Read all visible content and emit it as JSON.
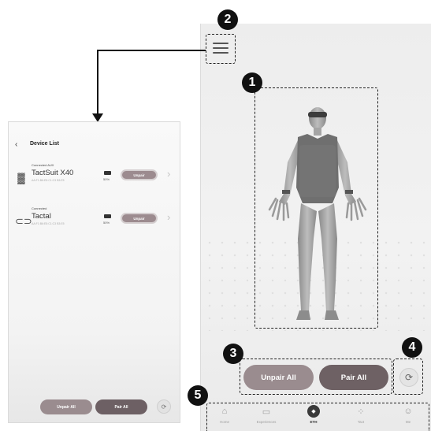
{
  "badges": [
    "1",
    "2",
    "3",
    "4",
    "5"
  ],
  "main": {
    "menu_icon": "hamburger-menu-icon",
    "unpair_all": "Unpair All",
    "pair_all": "Pair All",
    "refresh_icon": "refresh-icon",
    "refresh_glyph": "⟳"
  },
  "nav": {
    "items": [
      {
        "label": "Home",
        "icon": "home-icon",
        "glyph": "⌂"
      },
      {
        "label": "Experiences",
        "icon": "gamepad-icon",
        "glyph": "▭"
      },
      {
        "label": "ETH",
        "icon": "eth-icon",
        "glyph": "◆"
      },
      {
        "label": "Tact",
        "icon": "grid-icon",
        "glyph": "⁘"
      },
      {
        "label": "Me",
        "icon": "profile-icon",
        "glyph": "☺"
      }
    ],
    "active_index": 2
  },
  "device_list": {
    "title": "Device List",
    "back_glyph": "‹",
    "devices": [
      {
        "status": "Connected  AUX",
        "name": "TactSuit X40",
        "serial": "AA:F1:B6:E5:C1:C3 B3:E5",
        "battery": "50%",
        "unpair": "Unpair",
        "icon": "vest-icon",
        "glyph": "▓"
      },
      {
        "status": "Connected",
        "name": "Tactal",
        "serial": "AA:F1:B6:E5:C1:C3 B3:E5",
        "battery": "50%",
        "unpair": "Unpair",
        "icon": "glasses-icon",
        "glyph": "⊂⊃"
      }
    ],
    "unpair_all": "Unpair All",
    "pair_all": "Pair All",
    "refresh_glyph": "⟳"
  },
  "colors": {
    "unpair": "#9a8c8f",
    "pair": "#6e6164",
    "badge": "#111111"
  }
}
